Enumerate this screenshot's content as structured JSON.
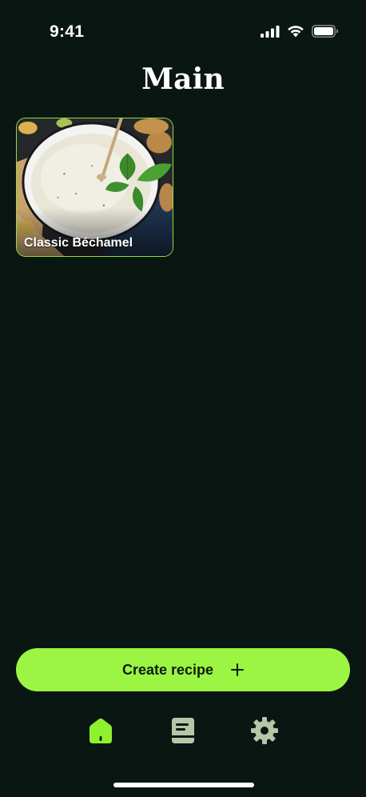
{
  "status_bar": {
    "time": "9:41",
    "icons": [
      "signal-icon",
      "wifi-icon",
      "battery-icon"
    ]
  },
  "header": {
    "title": "Main"
  },
  "recipes": [
    {
      "title": "Classic Béchamel",
      "image": "bechamel-sauce-photo"
    }
  ],
  "actions": {
    "create_label": "Create recipe",
    "create_icon": "plus-icon"
  },
  "tab_bar": {
    "active": "home",
    "tabs": [
      {
        "id": "home",
        "icon": "home-icon"
      },
      {
        "id": "recipes",
        "icon": "recipe-book-icon"
      },
      {
        "id": "settings",
        "icon": "gear-icon"
      }
    ]
  },
  "colors": {
    "background": "#0a1612",
    "accent": "#9bf542",
    "inactive_icon": "#b7c6a6"
  }
}
